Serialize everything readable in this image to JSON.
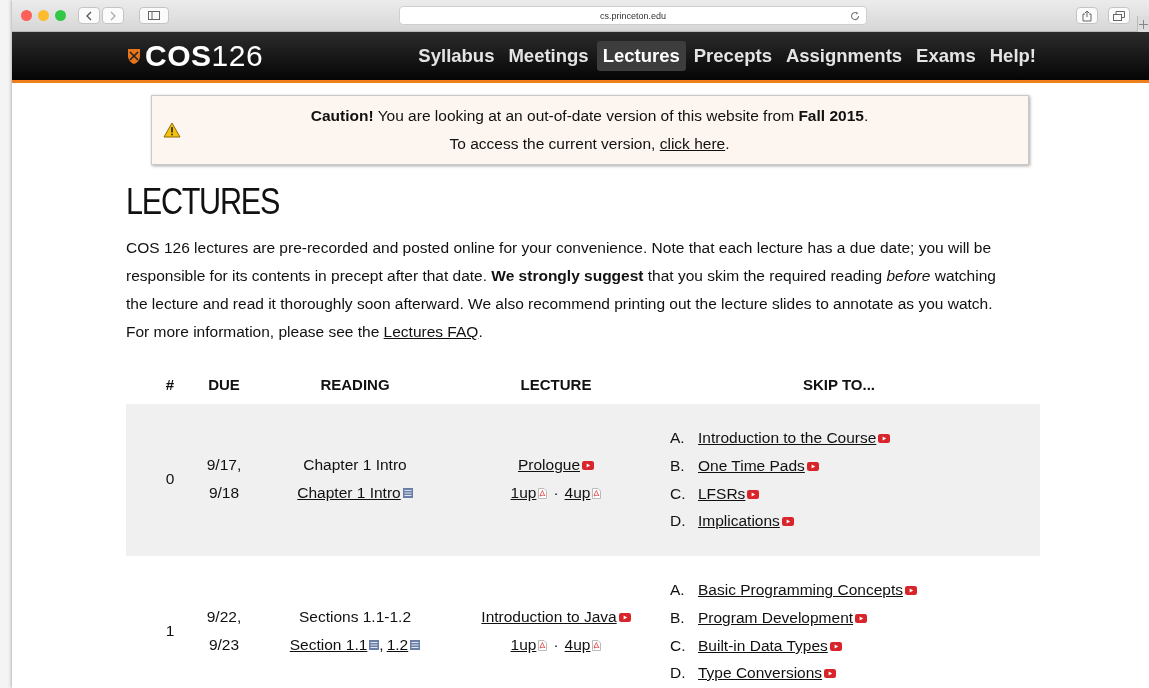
{
  "browser": {
    "url": "cs.princeton.edu"
  },
  "site": {
    "logo_bold": "COS",
    "logo_light": "126",
    "nav": [
      {
        "label": "Syllabus",
        "selected": false
      },
      {
        "label": "Meetings",
        "selected": false
      },
      {
        "label": "Lectures",
        "selected": true
      },
      {
        "label": "Precepts",
        "selected": false
      },
      {
        "label": "Assignments",
        "selected": false
      },
      {
        "label": "Exams",
        "selected": false
      },
      {
        "label": "Help!",
        "selected": false
      }
    ]
  },
  "notice": {
    "line_1": "**Caution!**  You are looking at an out-of-date version of this website from **Fall 2015**.",
    "line_2_before": "To access the current version,",
    "line_2_link": "click here",
    "line_2_after": "."
  },
  "page": {
    "title": "LECTURES",
    "intro_before": "COS 126 lectures are pre-recorded and posted online for your convenience. Note that each lecture has a due date; you will be responsible for its contents in precept after that date. **We strongly suggest** that you skim the required reading *before* watching the lecture and read it thoroughly soon afterward. We also recommend printing out the lecture slides to annotate as you watch. For more information, please see the",
    "intro_link": "Lectures FAQ",
    "intro_after": "."
  },
  "table": {
    "columns": [
      "#",
      "DUE",
      "READING",
      "LECTURE",
      "SKIP TO..."
    ],
    "rows": [
      {
        "number": "0",
        "due": [
          "9/17,",
          "9/18"
        ],
        "reading": {
          "text": "Chapter 1 Intro",
          "links": [
            "Chapter 1 Intro"
          ]
        },
        "lecture": {
          "title": "Prologue",
          "slides": [
            "1up",
            "4up"
          ],
          "separator": "·"
        },
        "skip_to": [
          {
            "letter": "A.",
            "label": "Introduction to the Course"
          },
          {
            "letter": "B.",
            "label": "One Time Pads"
          },
          {
            "letter": "C.",
            "label": "LFSRs"
          },
          {
            "letter": "D.",
            "label": "Implications"
          }
        ]
      },
      {
        "number": "1",
        "due": [
          "9/22,",
          "9/23"
        ],
        "reading": {
          "text": "Sections 1.1-1.2",
          "links": [
            "Section 1.1",
            "1.2"
          ],
          "separator": ","
        },
        "lecture": {
          "title": "Introduction to Java",
          "slides": [
            "1up",
            "4up"
          ],
          "separator": "·"
        },
        "skip_to": [
          {
            "letter": "A.",
            "label": "Basic Programming Concepts"
          },
          {
            "letter": "B.",
            "label": "Program Development"
          },
          {
            "letter": "C.",
            "label": "Built-in Data Types"
          },
          {
            "letter": "D.",
            "label": "Type Conversions"
          }
        ]
      }
    ]
  }
}
